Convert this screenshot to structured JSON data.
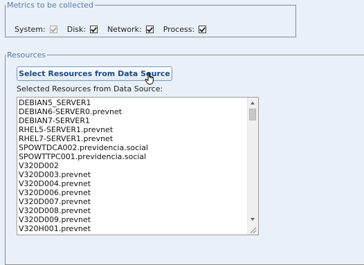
{
  "metrics": {
    "legend": "Metrics to be collected",
    "items": [
      {
        "label": "System:",
        "checked": true,
        "disabled": true
      },
      {
        "label": "Disk:",
        "checked": true,
        "disabled": false
      },
      {
        "label": "Network:",
        "checked": true,
        "disabled": false
      },
      {
        "label": "Process:",
        "checked": true,
        "disabled": false
      }
    ]
  },
  "resources": {
    "legend": "Resources",
    "select_button_label": "Select Resources from Data Source",
    "selected_label": "Selected Resources from Data Source:",
    "items": [
      "DEBIAN5_SERVER1",
      "DEBIAN6-SERVER0.prevnet",
      "DEBIAN7-SERVER1",
      "RHEL5-SERVER1.prevnet",
      "RHEL7-SERVER1.prevnet",
      "SPOWTDCA002.previdencia.social",
      "SPOWTTPC001.previdencia.social",
      "V320D002",
      "V320D003.prevnet",
      "V320D004.prevnet",
      "V320D006.prevnet",
      "V320D007.prevnet",
      "V320D008.prevnet",
      "V320D009.prevnet",
      "V320H001.prevnet"
    ]
  },
  "icons": {
    "scroll_up": "scroll-up-arrow-icon",
    "scroll_down": "scroll-down-arrow-icon",
    "resize": "resize-grip-icon",
    "cursor": "hand-pointer-icon"
  },
  "colors": {
    "background": "#e9f0f8",
    "legend_text": "#5a7ea8",
    "button_text": "#1c4a82"
  }
}
